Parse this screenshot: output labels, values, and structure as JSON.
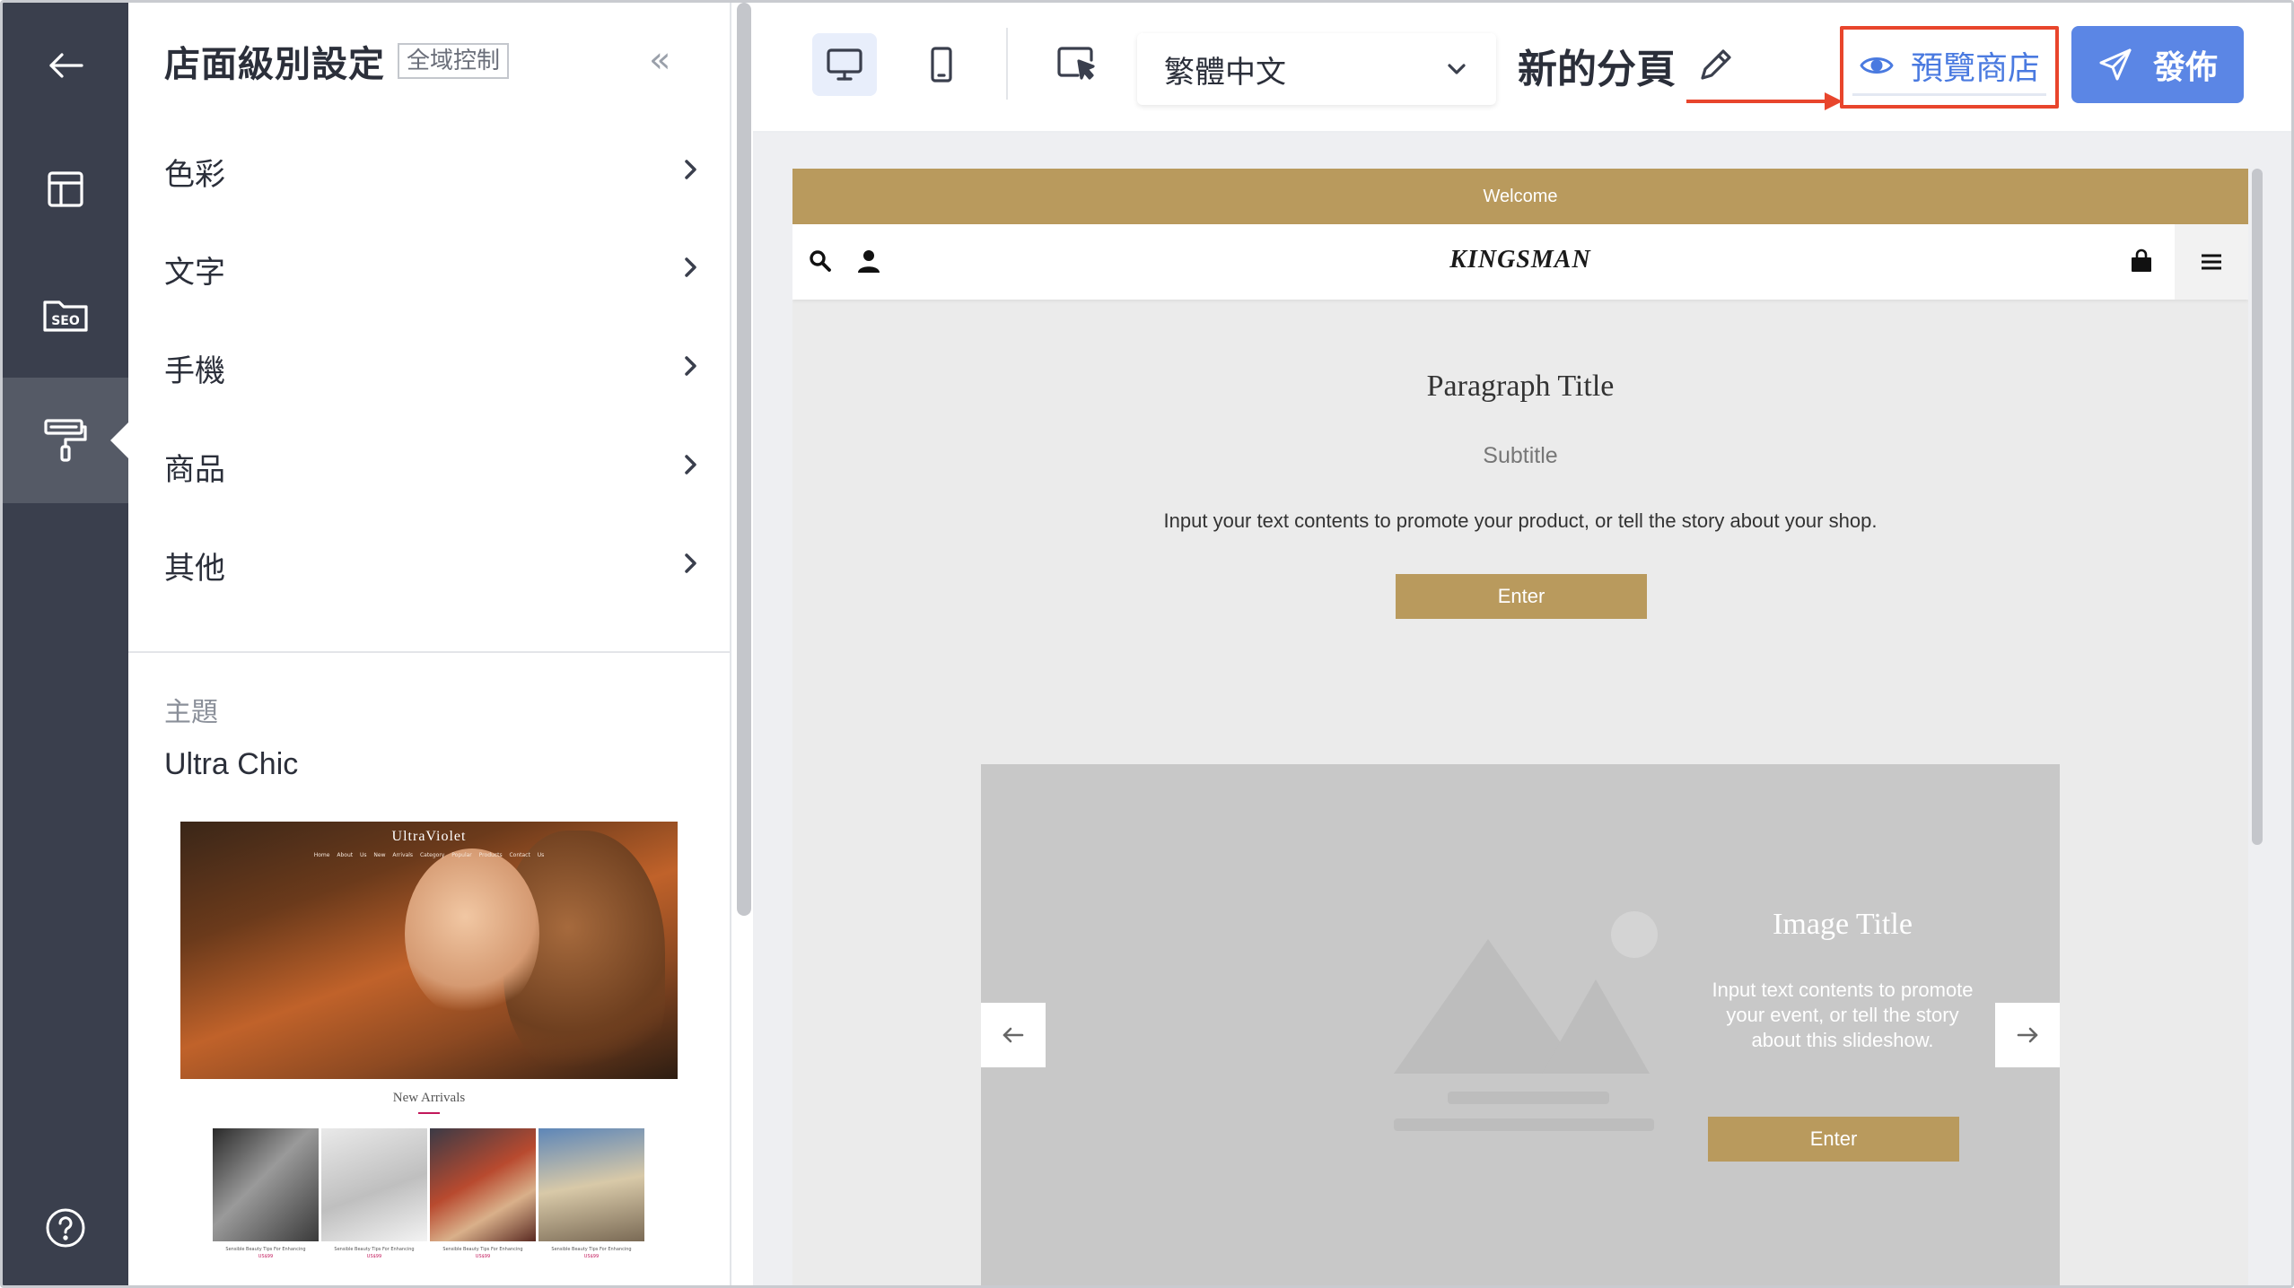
{
  "rail": {
    "items": [
      {
        "icon": "back-arrow-icon"
      },
      {
        "icon": "layout-icon"
      },
      {
        "icon": "seo-folder-icon",
        "label": "SEO"
      },
      {
        "icon": "paint-roller-icon",
        "active": true
      }
    ],
    "help_icon": "help-circle-icon"
  },
  "panel": {
    "title": "店面級別設定",
    "badge": "全域控制",
    "collapse_glyph": "«",
    "menu": [
      {
        "label": "色彩"
      },
      {
        "label": "文字"
      },
      {
        "label": "手機"
      },
      {
        "label": "商品"
      },
      {
        "label": "其他"
      }
    ],
    "theme_section_label": "主題",
    "theme_name": "Ultra Chic",
    "theme_preview": {
      "brand": "UltraViolet",
      "nav": "Home About Us New Arrivals Category Popular Products Contact Us",
      "section_title": "New Arrivals",
      "product_caption": "Sensible Beauty Tips For Enhancing",
      "product_price": "US$99"
    }
  },
  "toolbar": {
    "language": "繁體中文",
    "page_name": "新的分頁",
    "preview_label": "預覽商店",
    "publish_label": "發佈",
    "colors": {
      "accent": "#5b86e5",
      "highlight": "#e8452c"
    }
  },
  "site": {
    "welcome": "Welcome",
    "brand": "KINGSMAN",
    "paragraph": {
      "title": "Paragraph Title",
      "subtitle": "Subtitle",
      "body": "Input your text contents to promote your product, or tell the story about your shop.",
      "button": "Enter"
    },
    "slideshow": {
      "title": "Image Title",
      "body": "Input text contents to promote your event, or tell the story about this slideshow.",
      "button": "Enter"
    },
    "colors": {
      "gold": "#b99a5d"
    }
  }
}
